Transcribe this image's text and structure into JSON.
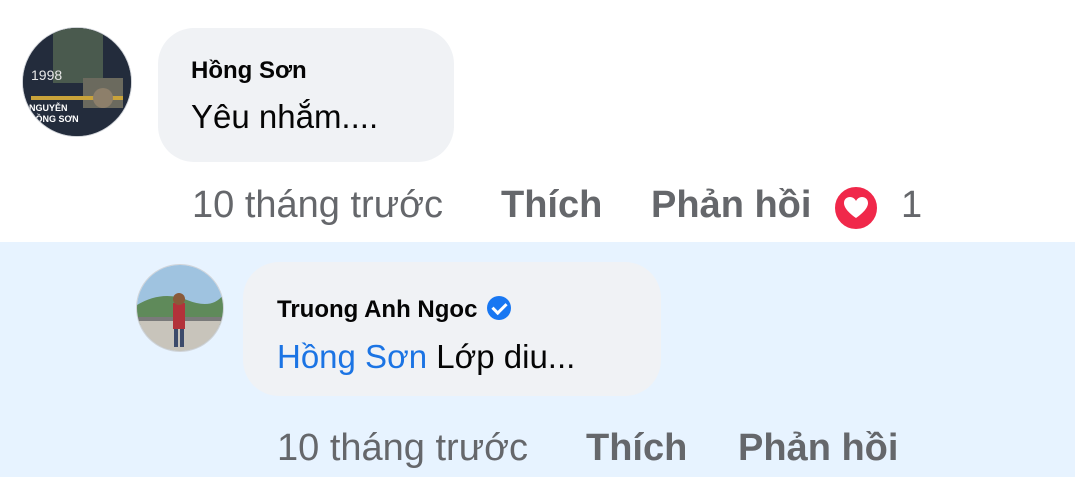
{
  "comment": {
    "author": "Hồng Sơn",
    "text": "Yêu nhắm....",
    "time": "10 tháng trước",
    "like_label": "Thích",
    "reply_label": "Phản hồi",
    "reaction_icon": "heart-icon",
    "reaction_count": "1",
    "avatar": {
      "year": "1998",
      "name_line1": "NGUYỄN",
      "name_line2": "HỒNG SƠN"
    }
  },
  "reply": {
    "author": "Truong Anh Ngoc",
    "verified_icon": "verified-badge-icon",
    "mention": "Hồng Sơn",
    "text": " Lớp diu...",
    "time": "10 tháng trước",
    "like_label": "Thích",
    "reply_label": "Phản hồi"
  },
  "colors": {
    "reply_highlight": "#e7f3ff",
    "bubble": "#f0f2f5",
    "mention": "#1b74e4",
    "heart": "#f0284a",
    "verified": "#1877f2"
  }
}
